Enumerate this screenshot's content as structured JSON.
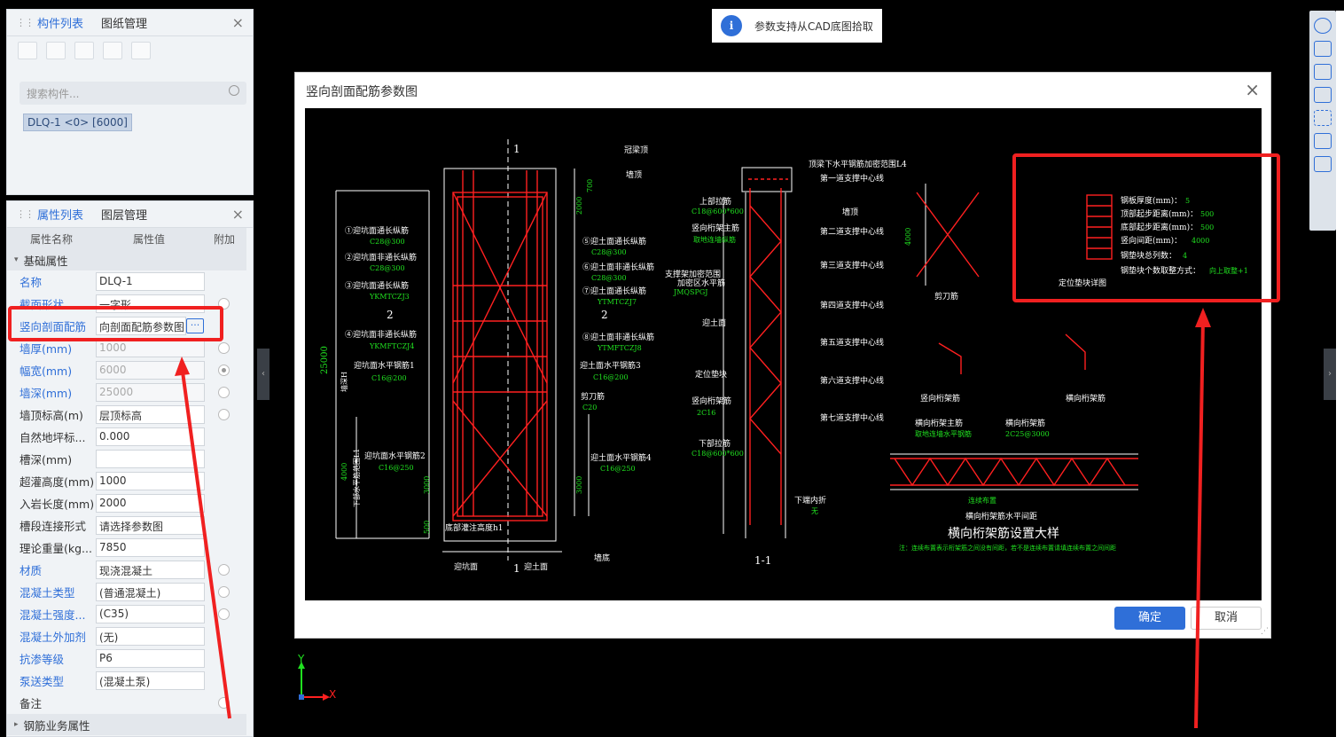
{
  "left_top_panel": {
    "tabs": [
      "构件列表",
      "图纸管理"
    ],
    "search_placeholder": "搜索构件...",
    "component": "DLQ-1 <0> [6000]"
  },
  "prop_panel": {
    "tabs": [
      "属性列表",
      "图层管理"
    ],
    "header": [
      "属性名称",
      "属性值",
      "附加"
    ],
    "section_basic": "基础属性",
    "rows": [
      {
        "k": "名称",
        "v": "DLQ-1"
      },
      {
        "k": "截面形状",
        "v": "一字形"
      },
      {
        "k": "竖向剖面配筋",
        "v": "向剖面配筋参数图"
      },
      {
        "k": "墙厚(mm)",
        "v": "1000"
      },
      {
        "k": "幅宽(mm)",
        "v": "6000"
      },
      {
        "k": "墙深(mm)",
        "v": "25000"
      },
      {
        "k": "墙顶标高(m)",
        "v": "层顶标高"
      },
      {
        "k": "自然地坪标...",
        "v": "0.000"
      },
      {
        "k": "槽深(mm)",
        "v": ""
      },
      {
        "k": "超灌高度(mm)",
        "v": "1000"
      },
      {
        "k": "入岩长度(mm)",
        "v": "2000"
      },
      {
        "k": "槽段连接形式",
        "v": "请选择参数图"
      },
      {
        "k": "理论重量(kg...",
        "v": "7850"
      },
      {
        "k": "材质",
        "v": "现浇混凝土"
      },
      {
        "k": "混凝土类型",
        "v": "(普通混凝土)"
      },
      {
        "k": "混凝土强度...",
        "v": "(C35)"
      },
      {
        "k": "混凝土外加剂",
        "v": "(无)"
      },
      {
        "k": "抗渗等级",
        "v": "P6"
      },
      {
        "k": "泵送类型",
        "v": "(混凝土泵)"
      },
      {
        "k": "备注",
        "v": ""
      }
    ],
    "section_rebar": "钢筋业务属性"
  },
  "toast": {
    "icon": "i",
    "text": "参数支持从CAD底图拾取"
  },
  "dialog": {
    "title": "竖向剖面配筋参数图",
    "ok": "确定",
    "cancel": "取消"
  },
  "cad": {
    "lbl_1": "1",
    "guan_liang_ding": "冠梁顶",
    "qiang_ding": "墙顶",
    "qiang_di": "墙底",
    "ying_keng_mian": "迎坑面",
    "ying_tu_mian": "迎土面",
    "n1": "①迎坑面通长纵筋",
    "n1v": "C28@300",
    "n2": "②迎坑面非通长纵筋",
    "n2v": "C28@300",
    "n3": "③迎坑面通长纵筋",
    "n3v": "YKMTCZJ3",
    "n4": "④迎坑面非通长纵筋",
    "n4v": "YKMFTCZJ4",
    "n5": "⑤迎土面通长纵筋",
    "n5v": "C28@300",
    "n6": "⑥迎土面非通长纵筋",
    "n6v": "C28@300",
    "n7": "⑦迎土面通长纵筋",
    "n7v": "YTMTCZJ7",
    "n8": "⑧迎土面非通长纵筋",
    "n8v": "YTMFTCZJ8",
    "kh1": "迎坑面水平钢筋1",
    "kh1v": "C16@200",
    "th3": "迎土面水平钢筋3",
    "th3v": "C16@200",
    "jd": "剪刀筋",
    "jdv": "C20",
    "kh2": "迎坑面水平钢筋2",
    "kh2v": "C16@250",
    "th4": "迎土面水平钢筋4",
    "th4v": "C16@250",
    "dibu": "底部灌注高度h1",
    "d25000": "25000",
    "qiangshen": "墙深H",
    "d4000": "4000",
    "xiabu": "下部水平筋范围L1",
    "d3000a": "3000",
    "d3000b": "3000",
    "d500": "500",
    "d700": "700",
    "d2000": "2000",
    "two": "2",
    "sec": "1-1",
    "top_range": "顶梁下水平钢筋加密范围L4",
    "s1": "第一道支撑中心线",
    "s2": "第二道支撑中心线",
    "s3": "第三道支撑中心线",
    "s4": "第四道支撑中心线",
    "s5": "第五道支撑中心线",
    "s6": "第六道支撑中心线",
    "s7": "第七道支撑中心线",
    "sbj": "上部拉筋",
    "sbjv": "C18@600*600",
    "sxhj": "竖向桁架主筋",
    "sxhjv": "取地连墙纵筋",
    "zcj": "支撑架加密范围",
    "jmq": "加密区水平筋",
    "jmqv": "JMQSPGJ",
    "ytm": "迎土面",
    "dwdk": "定位垫块",
    "sxhjj": "竖向桁架筋",
    "sxhjjv": "2C16",
    "xblj": "下部拉筋",
    "xbljv": "C18@600*600",
    "xdnz": "下端内折",
    "xdnzv": "无",
    "jdj": "剪刀筋",
    "qd": "墙顶",
    "sxhjj2": "竖向桁架筋",
    "hxhjj": "横向桁架筋",
    "hxhjz": "横向桁架主筋",
    "hxhjzv": "取地连墙水平钢筋",
    "hxhjj2": "横向桁架筋",
    "hxhjj2v": "2C25@3000",
    "lxbz": "连续布置",
    "hxjj": "横向桁架筋水平间距",
    "big_title": "横向桁架筋设置大样",
    "note": "注：连续布置表示桁架筋之间没有间距，若不是连续布置请填连续布置之间间距",
    "d4000b": "4000",
    "gbhd": "钢板厚度(mm)：",
    "gbhdv": "5",
    "dbqb": "顶部起步距离(mm)：",
    "dbqbv": "500",
    "dbqb2": "底部起步距离(mm)：",
    "dbqb2v": "500",
    "sxjj": "竖向间距(mm)：",
    "sxjjv": "4000",
    "gdk": "钢垫块总列数：",
    "gdkv": "4",
    "gdkgs": "钢垫块个数取整方式：",
    "gdkgsv": "向上取整+1",
    "dwdkxt": "定位垫块详图"
  },
  "axes": {
    "y": "Y",
    "x": "X"
  },
  "colors": {
    "accent": "#2f6fd8",
    "highlight": "#f02020",
    "cad_red": "#ff2020",
    "cad_green": "#20e020"
  }
}
